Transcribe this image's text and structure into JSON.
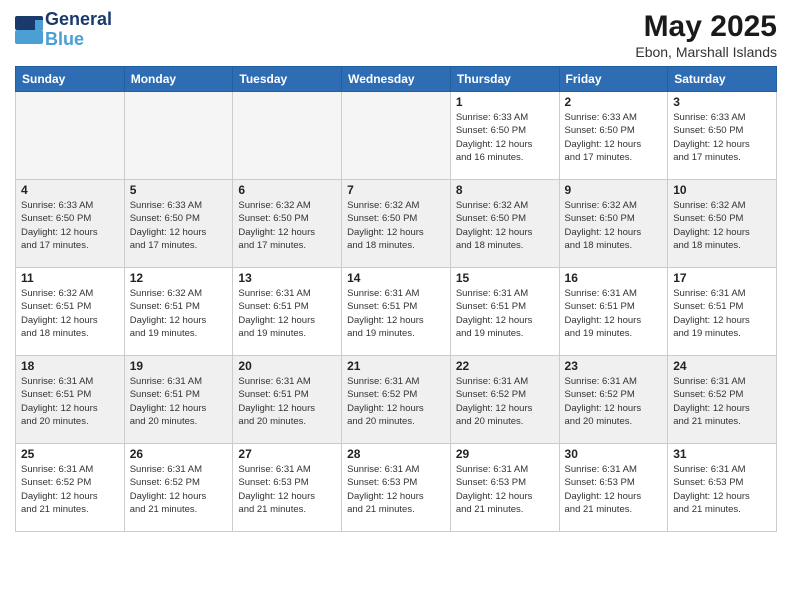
{
  "header": {
    "logo_line1": "General",
    "logo_line2": "Blue",
    "month": "May 2025",
    "location": "Ebon, Marshall Islands"
  },
  "weekdays": [
    "Sunday",
    "Monday",
    "Tuesday",
    "Wednesday",
    "Thursday",
    "Friday",
    "Saturday"
  ],
  "weeks": [
    [
      {
        "day": "",
        "info": ""
      },
      {
        "day": "",
        "info": ""
      },
      {
        "day": "",
        "info": ""
      },
      {
        "day": "",
        "info": ""
      },
      {
        "day": "1",
        "info": "Sunrise: 6:33 AM\nSunset: 6:50 PM\nDaylight: 12 hours\nand 16 minutes."
      },
      {
        "day": "2",
        "info": "Sunrise: 6:33 AM\nSunset: 6:50 PM\nDaylight: 12 hours\nand 17 minutes."
      },
      {
        "day": "3",
        "info": "Sunrise: 6:33 AM\nSunset: 6:50 PM\nDaylight: 12 hours\nand 17 minutes."
      }
    ],
    [
      {
        "day": "4",
        "info": "Sunrise: 6:33 AM\nSunset: 6:50 PM\nDaylight: 12 hours\nand 17 minutes."
      },
      {
        "day": "5",
        "info": "Sunrise: 6:33 AM\nSunset: 6:50 PM\nDaylight: 12 hours\nand 17 minutes."
      },
      {
        "day": "6",
        "info": "Sunrise: 6:32 AM\nSunset: 6:50 PM\nDaylight: 12 hours\nand 17 minutes."
      },
      {
        "day": "7",
        "info": "Sunrise: 6:32 AM\nSunset: 6:50 PM\nDaylight: 12 hours\nand 18 minutes."
      },
      {
        "day": "8",
        "info": "Sunrise: 6:32 AM\nSunset: 6:50 PM\nDaylight: 12 hours\nand 18 minutes."
      },
      {
        "day": "9",
        "info": "Sunrise: 6:32 AM\nSunset: 6:50 PM\nDaylight: 12 hours\nand 18 minutes."
      },
      {
        "day": "10",
        "info": "Sunrise: 6:32 AM\nSunset: 6:50 PM\nDaylight: 12 hours\nand 18 minutes."
      }
    ],
    [
      {
        "day": "11",
        "info": "Sunrise: 6:32 AM\nSunset: 6:51 PM\nDaylight: 12 hours\nand 18 minutes."
      },
      {
        "day": "12",
        "info": "Sunrise: 6:32 AM\nSunset: 6:51 PM\nDaylight: 12 hours\nand 19 minutes."
      },
      {
        "day": "13",
        "info": "Sunrise: 6:31 AM\nSunset: 6:51 PM\nDaylight: 12 hours\nand 19 minutes."
      },
      {
        "day": "14",
        "info": "Sunrise: 6:31 AM\nSunset: 6:51 PM\nDaylight: 12 hours\nand 19 minutes."
      },
      {
        "day": "15",
        "info": "Sunrise: 6:31 AM\nSunset: 6:51 PM\nDaylight: 12 hours\nand 19 minutes."
      },
      {
        "day": "16",
        "info": "Sunrise: 6:31 AM\nSunset: 6:51 PM\nDaylight: 12 hours\nand 19 minutes."
      },
      {
        "day": "17",
        "info": "Sunrise: 6:31 AM\nSunset: 6:51 PM\nDaylight: 12 hours\nand 19 minutes."
      }
    ],
    [
      {
        "day": "18",
        "info": "Sunrise: 6:31 AM\nSunset: 6:51 PM\nDaylight: 12 hours\nand 20 minutes."
      },
      {
        "day": "19",
        "info": "Sunrise: 6:31 AM\nSunset: 6:51 PM\nDaylight: 12 hours\nand 20 minutes."
      },
      {
        "day": "20",
        "info": "Sunrise: 6:31 AM\nSunset: 6:51 PM\nDaylight: 12 hours\nand 20 minutes."
      },
      {
        "day": "21",
        "info": "Sunrise: 6:31 AM\nSunset: 6:52 PM\nDaylight: 12 hours\nand 20 minutes."
      },
      {
        "day": "22",
        "info": "Sunrise: 6:31 AM\nSunset: 6:52 PM\nDaylight: 12 hours\nand 20 minutes."
      },
      {
        "day": "23",
        "info": "Sunrise: 6:31 AM\nSunset: 6:52 PM\nDaylight: 12 hours\nand 20 minutes."
      },
      {
        "day": "24",
        "info": "Sunrise: 6:31 AM\nSunset: 6:52 PM\nDaylight: 12 hours\nand 21 minutes."
      }
    ],
    [
      {
        "day": "25",
        "info": "Sunrise: 6:31 AM\nSunset: 6:52 PM\nDaylight: 12 hours\nand 21 minutes."
      },
      {
        "day": "26",
        "info": "Sunrise: 6:31 AM\nSunset: 6:52 PM\nDaylight: 12 hours\nand 21 minutes."
      },
      {
        "day": "27",
        "info": "Sunrise: 6:31 AM\nSunset: 6:53 PM\nDaylight: 12 hours\nand 21 minutes."
      },
      {
        "day": "28",
        "info": "Sunrise: 6:31 AM\nSunset: 6:53 PM\nDaylight: 12 hours\nand 21 minutes."
      },
      {
        "day": "29",
        "info": "Sunrise: 6:31 AM\nSunset: 6:53 PM\nDaylight: 12 hours\nand 21 minutes."
      },
      {
        "day": "30",
        "info": "Sunrise: 6:31 AM\nSunset: 6:53 PM\nDaylight: 12 hours\nand 21 minutes."
      },
      {
        "day": "31",
        "info": "Sunrise: 6:31 AM\nSunset: 6:53 PM\nDaylight: 12 hours\nand 21 minutes."
      }
    ]
  ]
}
